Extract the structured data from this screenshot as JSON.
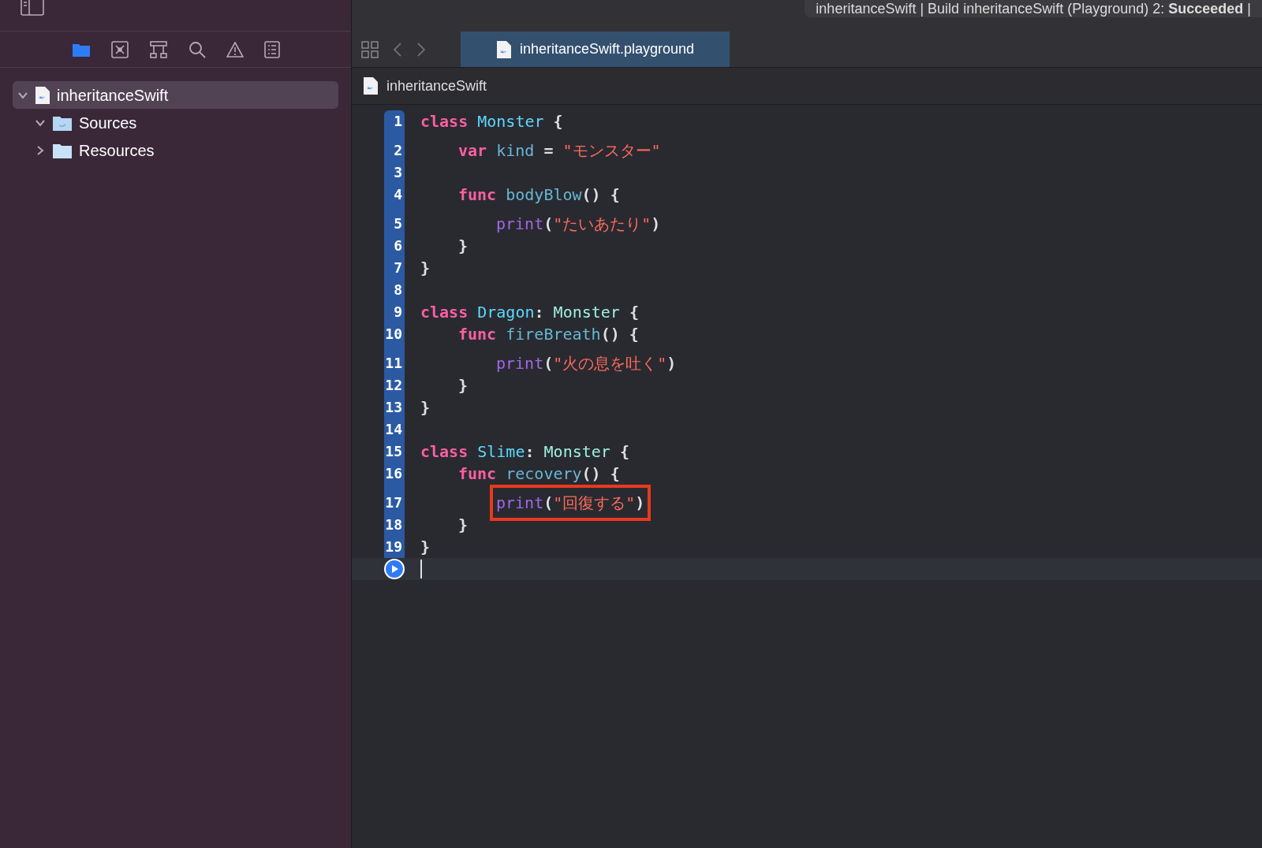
{
  "activity": {
    "text": "inheritanceSwift | Build inheritanceSwift (Playground) 2: **Succeeded** |"
  },
  "navigator_tabs": [
    {
      "kind": "folder",
      "selected": true
    },
    {
      "kind": "source-control",
      "selected": false
    },
    {
      "kind": "hierarchy",
      "selected": false
    },
    {
      "kind": "search",
      "selected": false
    },
    {
      "kind": "warning",
      "selected": false
    },
    {
      "kind": "list",
      "selected": false
    }
  ],
  "tree": [
    {
      "label": "inheritanceSwift",
      "kind": "swift-file",
      "selected": true,
      "expanded": true,
      "children": [
        {
          "label": "Sources",
          "kind": "swift-folder",
          "selected": false,
          "expanded": true
        },
        {
          "label": "Resources",
          "kind": "folder",
          "selected": false,
          "expanded": false
        }
      ]
    }
  ],
  "tabs": [
    {
      "label": "inheritanceSwift.playground",
      "selected": true
    }
  ],
  "jump_bar": {
    "label": "inheritanceSwift"
  },
  "code": [
    {
      "number": "1",
      "kind": "top",
      "highlight": false,
      "tokens": [
        {
          "kind": "keyword",
          "text": "class "
        },
        {
          "kind": "decl",
          "text": "Monster"
        },
        {
          "kind": "plain",
          "text": " {"
        }
      ]
    },
    {
      "number": "2",
      "kind": "member",
      "highlight": false,
      "tokens": [
        {
          "kind": "keyword",
          "text": "var "
        },
        {
          "kind": "ident",
          "text": "kind"
        },
        {
          "kind": "plain",
          "text": " = "
        },
        {
          "kind": "string",
          "text": "\"モンスター\""
        }
      ]
    },
    {
      "number": "3",
      "kind": "top",
      "highlight": false
    },
    {
      "number": "4",
      "kind": "member",
      "highlight": false,
      "tokens": [
        {
          "kind": "keyword",
          "text": "func "
        },
        {
          "kind": "ident",
          "text": "bodyBlow"
        },
        {
          "kind": "plain",
          "text": "() {"
        }
      ]
    },
    {
      "number": "5",
      "kind": "statement",
      "highlight": false,
      "tokens": [
        {
          "kind": "call",
          "text": "print"
        },
        {
          "kind": "plain",
          "text": "("
        },
        {
          "kind": "string",
          "text": "\"たいあたり\""
        },
        {
          "kind": "plain",
          "text": ")"
        }
      ]
    },
    {
      "number": "6",
      "kind": "member",
      "highlight": false,
      "tokens": [
        {
          "kind": "plain",
          "text": "}"
        }
      ]
    },
    {
      "number": "7",
      "kind": "top",
      "highlight": false,
      "tokens": [
        {
          "kind": "plain",
          "text": "}"
        }
      ]
    },
    {
      "number": "8",
      "kind": "top",
      "highlight": false
    },
    {
      "number": "9",
      "kind": "top",
      "highlight": false,
      "tokens": [
        {
          "kind": "keyword",
          "text": "class "
        },
        {
          "kind": "decl",
          "text": "Dragon"
        },
        {
          "kind": "plain",
          "text": ": "
        },
        {
          "kind": "type",
          "text": "Monster"
        },
        {
          "kind": "plain",
          "text": " {"
        }
      ]
    },
    {
      "number": "10",
      "kind": "member",
      "highlight": false,
      "tokens": [
        {
          "kind": "keyword",
          "text": "func "
        },
        {
          "kind": "ident",
          "text": "fireBreath"
        },
        {
          "kind": "plain",
          "text": "() {"
        }
      ]
    },
    {
      "number": "11",
      "kind": "statement",
      "highlight": false,
      "tokens": [
        {
          "kind": "call",
          "text": "print"
        },
        {
          "kind": "plain",
          "text": "("
        },
        {
          "kind": "string",
          "text": "\"火の息を吐く\""
        },
        {
          "kind": "plain",
          "text": ")"
        }
      ]
    },
    {
      "number": "12",
      "kind": "member",
      "highlight": false,
      "tokens": [
        {
          "kind": "plain",
          "text": "}"
        }
      ]
    },
    {
      "number": "13",
      "kind": "top",
      "highlight": false,
      "tokens": [
        {
          "kind": "plain",
          "text": "}"
        }
      ]
    },
    {
      "number": "14",
      "kind": "top",
      "highlight": false
    },
    {
      "number": "15",
      "kind": "top",
      "highlight": false,
      "tokens": [
        {
          "kind": "keyword",
          "text": "class "
        },
        {
          "kind": "decl",
          "text": "Slime"
        },
        {
          "kind": "plain",
          "text": ": "
        },
        {
          "kind": "type",
          "text": "Monster"
        },
        {
          "kind": "plain",
          "text": " {"
        }
      ]
    },
    {
      "number": "16",
      "kind": "member",
      "highlight": false,
      "tokens": [
        {
          "kind": "keyword",
          "text": "func "
        },
        {
          "kind": "ident",
          "text": "recovery"
        },
        {
          "kind": "plain",
          "text": "() {"
        }
      ]
    },
    {
      "number": "17",
      "kind": "statement",
      "highlight": true,
      "tokens": [
        {
          "kind": "call",
          "text": "print"
        },
        {
          "kind": "plain",
          "text": "("
        },
        {
          "kind": "string",
          "text": "\"回復する\""
        },
        {
          "kind": "plain",
          "text": ")"
        }
      ]
    },
    {
      "number": "18",
      "kind": "member",
      "highlight": false,
      "tokens": [
        {
          "kind": "plain",
          "text": "}"
        }
      ]
    },
    {
      "number": "19",
      "kind": "top",
      "highlight": false,
      "tokens": [
        {
          "kind": "plain",
          "text": "}"
        }
      ]
    }
  ]
}
